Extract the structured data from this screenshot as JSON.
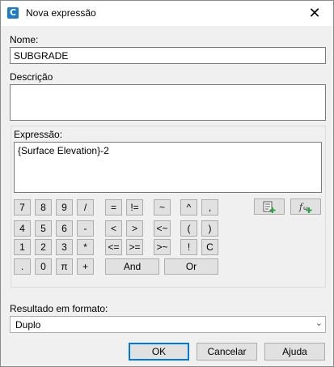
{
  "window": {
    "title": "Nova expressão",
    "close_glyph": "✕"
  },
  "name": {
    "label": "Nome:",
    "value": "SUBGRADE"
  },
  "description": {
    "label": "Descrição",
    "value": ""
  },
  "expression": {
    "label": "Expressão:",
    "value": "{Surface Elevation}-2"
  },
  "keypad": {
    "row1": [
      "7",
      "8",
      "9",
      "/",
      "=",
      "!=",
      "~",
      "^",
      ","
    ],
    "row2": [
      "4",
      "5",
      "6",
      "-",
      "<",
      ">",
      "<~",
      "(",
      ")"
    ],
    "row3": [
      "1",
      "2",
      "3",
      "*",
      "<=",
      ">=",
      ">~",
      "!",
      "C"
    ],
    "row4": [
      ".",
      "0",
      "π",
      "+"
    ],
    "and_label": "And",
    "or_label": "Or"
  },
  "icons": {
    "insert_property": "insert-property-icon",
    "insert_function": "insert-function-icon"
  },
  "result_format": {
    "label": "Resultado em formato:",
    "value": "Duplo",
    "arrow": "⌄"
  },
  "buttons": {
    "ok": "OK",
    "cancel": "Cancelar",
    "help": "Ajuda"
  },
  "colors": {
    "accent": "#0078d7",
    "add_green": "#2ea043"
  }
}
